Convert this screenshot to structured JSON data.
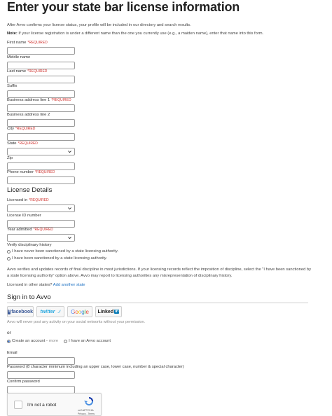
{
  "page": {
    "title": "Enter your state bar license information",
    "intro": "After Avvo confirms your license status, your profile will be included in our directory and search results.",
    "note_label": "Note:",
    "note_text": " If your license registration is under a different name than the one you currently use (e.g., a maiden name), enter that name into this form."
  },
  "fields": {
    "first_name": "First name",
    "middle_name": "Middle name",
    "last_name": "Last name",
    "suffix": "Suffix",
    "address1": "Business address line 1",
    "address2": "Business address line 2",
    "city": "City",
    "state": "State",
    "zip": "Zip",
    "phone": "Phone number",
    "required": "*REQUIRED"
  },
  "license": {
    "heading": "License Details",
    "licensed_in": "Licensed in",
    "license_id": "License ID number",
    "year_admitted": "Year admitted",
    "verify_label": "Verify disciplinary history",
    "option_never": "I have never been sanctioned by a state licensing authority.",
    "option_been": "I have been sanctioned by a state licensing authority.",
    "disclaimer_1": "Avvo verifies and updates records of final discipline in most jurisdictions. If your licensing records reflect the imposition of discipline, select the \"I have been sanctioned by",
    "disclaimer_2": "a state licensing authority\" option above. Avvo may report to licensing authorities any misrepresentation of disciplinary history.",
    "other_states_label": "Licensed in other states?",
    "add_state_link": "Add another state"
  },
  "signin": {
    "heading": "Sign in to Avvo",
    "facebook": "facebook",
    "twitter": "twitter",
    "google": "Google",
    "linkedin": "Linked",
    "linkedin_in": "in",
    "privacy": "Avvo will never post any activity on your social networks without your permission.",
    "or": "or",
    "create_account": "Create an account -",
    "more": "more",
    "have_account": "I have an Avvo account",
    "email": "Email",
    "password": "Password (8 character minimum including an upper case, lower case, number & special character)",
    "confirm_password": "Confirm password"
  },
  "captcha": {
    "label": "I'm not a robot",
    "brand": "reCAPTCHA",
    "terms": "Privacy - Terms"
  },
  "colors": {
    "required": "#d0332f",
    "link": "#1a6fc2",
    "facebook": "#3b5998",
    "twitter": "#2aa9e0",
    "linkedin": "#0077b5"
  }
}
